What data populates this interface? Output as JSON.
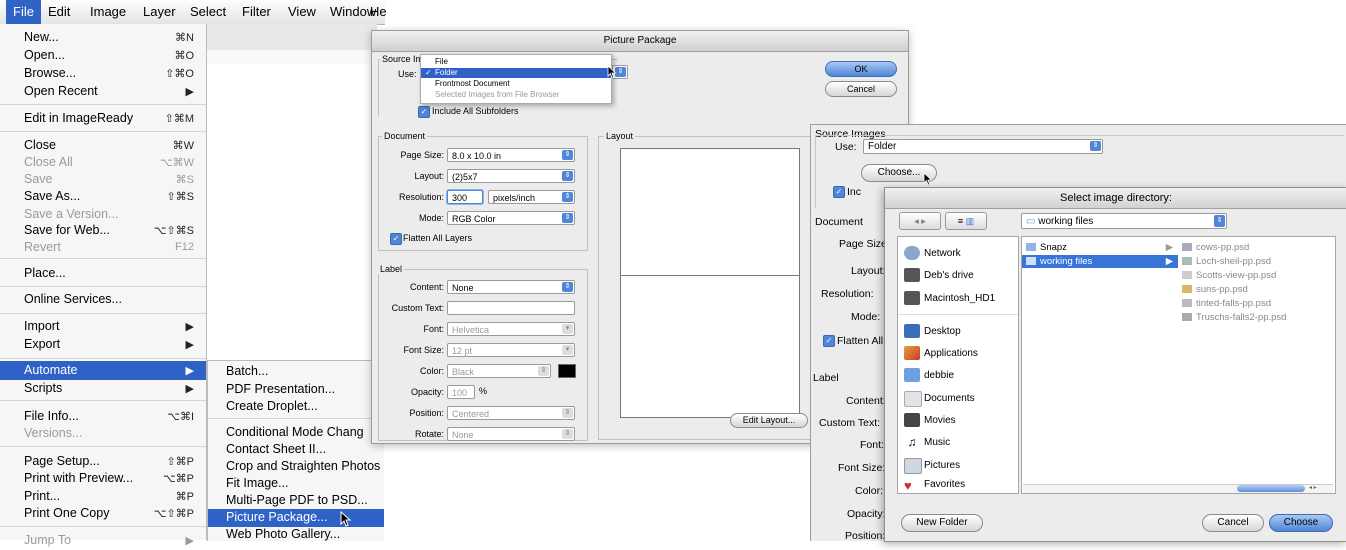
{
  "menubar": [
    "File",
    "Edit",
    "Image",
    "Layer",
    "Select",
    "Filter",
    "View",
    "Window",
    "He"
  ],
  "file_menu": {
    "items": [
      {
        "label": "New...",
        "shortcut": "⌘N",
        "enabled": true
      },
      {
        "label": "Open...",
        "shortcut": "⌘O",
        "enabled": true
      },
      {
        "label": "Browse...",
        "shortcut": "⇧⌘O",
        "enabled": true
      },
      {
        "label": "Open Recent",
        "shortcut": "▶",
        "enabled": true
      },
      {
        "label": "Edit in ImageReady",
        "shortcut": "⇧⌘M",
        "enabled": true
      },
      {
        "label": "Close",
        "shortcut": "⌘W",
        "enabled": true
      },
      {
        "label": "Close All",
        "shortcut": "⌥⌘W",
        "enabled": false
      },
      {
        "label": "Save",
        "shortcut": "⌘S",
        "enabled": false
      },
      {
        "label": "Save As...",
        "shortcut": "⇧⌘S",
        "enabled": true
      },
      {
        "label": "Save a Version...",
        "shortcut": "",
        "enabled": false
      },
      {
        "label": "Save for Web...",
        "shortcut": "⌥⇧⌘S",
        "enabled": true
      },
      {
        "label": "Revert",
        "shortcut": "F12",
        "enabled": false
      },
      {
        "label": "Place...",
        "shortcut": "",
        "enabled": true
      },
      {
        "label": "Online Services...",
        "shortcut": "",
        "enabled": true
      },
      {
        "label": "Import",
        "shortcut": "▶",
        "enabled": true
      },
      {
        "label": "Export",
        "shortcut": "▶",
        "enabled": true
      },
      {
        "label": "Automate",
        "shortcut": "▶",
        "enabled": true,
        "selected": true
      },
      {
        "label": "Scripts",
        "shortcut": "▶",
        "enabled": true
      },
      {
        "label": "File Info...",
        "shortcut": "⌥⌘I",
        "enabled": true
      },
      {
        "label": "Versions...",
        "shortcut": "",
        "enabled": false
      },
      {
        "label": "Page Setup...",
        "shortcut": "⇧⌘P",
        "enabled": true
      },
      {
        "label": "Print with Preview...",
        "shortcut": "⌥⌘P",
        "enabled": true
      },
      {
        "label": "Print...",
        "shortcut": "⌘P",
        "enabled": true
      },
      {
        "label": "Print One Copy",
        "shortcut": "⌥⇧⌘P",
        "enabled": true
      },
      {
        "label": "Jump To",
        "shortcut": "▶",
        "enabled": false
      }
    ]
  },
  "automate_menu": [
    "Batch...",
    "PDF Presentation...",
    "Create Droplet...",
    "Conditional Mode Chang",
    "Contact Sheet II...",
    "Crop and Straighten Photos",
    "Fit Image...",
    "Multi-Page PDF to PSD...",
    "Picture Package...",
    "Web Photo Gallery..."
  ],
  "picture_package": {
    "title": "Picture Package",
    "source_group": "Source Im",
    "use_label": "Use:",
    "use_menu": [
      {
        "label": "File",
        "checked": false
      },
      {
        "label": "Folder",
        "checked": true
      },
      {
        "label": "Frontmost Document",
        "checked": false
      },
      {
        "label": "Selected Images from File Browser",
        "checked": false,
        "disabled": true
      }
    ],
    "include_subfolders": "Include All Subfolders",
    "ok": "OK",
    "cancel": "Cancel",
    "document_group": "Document",
    "page_size_label": "Page Size:",
    "page_size": "8.0 x 10.0 in",
    "layout_label": "Layout:",
    "layout": "(2)5x7",
    "resolution_label": "Resolution:",
    "resolution": "300",
    "resolution_unit": "pixels/inch",
    "mode_label": "Mode:",
    "mode": "RGB Color",
    "flatten": "Flatten All Layers",
    "label_group": "Label",
    "content_label": "Content:",
    "content": "None",
    "custom_text_label": "Custom Text:",
    "custom_text": "",
    "font_label": "Font:",
    "font": "Helvetica",
    "font_size_label": "Font Size:",
    "font_size": "12 pt",
    "color_label": "Color:",
    "color": "Black",
    "opacity_label": "Opacity:",
    "opacity": "100",
    "opacity_unit": "%",
    "position_label": "Position:",
    "position": "Centered",
    "rotate_label": "Rotate:",
    "rotate": "None",
    "layout_group": "Layout",
    "edit_layout": "Edit Layout..."
  },
  "right_dialog": {
    "source_images": "Source Images",
    "use_label": "Use:",
    "use_value": "Folder",
    "choose": "Choose...",
    "include": "Inc",
    "document": "Document",
    "page_size": "Page Size:",
    "layout": "Layout:",
    "resolution": "Resolution:",
    "mode": "Mode:",
    "flatten": "Flatten All",
    "label": "Label",
    "content": "Content:",
    "custom_text": "Custom Text:",
    "font": "Font:",
    "font_size": "Font Size:",
    "color": "Color:",
    "opacity": "Opacity:",
    "position": "Position:"
  },
  "select_dir": {
    "title": "Select image directory:",
    "path": "working files",
    "sidebar": [
      {
        "label": "Network",
        "icon": "network-icon"
      },
      {
        "label": "Deb's drive",
        "icon": "drive-icon"
      },
      {
        "label": "Macintosh_HD1",
        "icon": "drive-icon"
      },
      {
        "label": "Desktop",
        "icon": "desktop-icon"
      },
      {
        "label": "Applications",
        "icon": "applications-icon"
      },
      {
        "label": "debbie",
        "icon": "home-icon"
      },
      {
        "label": "Documents",
        "icon": "documents-icon"
      },
      {
        "label": "Movies",
        "icon": "movies-icon"
      },
      {
        "label": "Music",
        "icon": "music-icon"
      },
      {
        "label": "Pictures",
        "icon": "pictures-icon"
      },
      {
        "label": "Favorites",
        "icon": "favorites-icon"
      }
    ],
    "folders": [
      {
        "label": "Snapz",
        "selected": false
      },
      {
        "label": "working files",
        "selected": true
      }
    ],
    "files": [
      "cows-pp.psd",
      "Loch-sheil-pp.psd",
      "Scotts-view-pp.psd",
      "suns-pp.psd",
      "tinted-falls-pp.psd",
      "Truschs-falls2-pp.psd"
    ],
    "new_folder": "New Folder",
    "cancel": "Cancel",
    "choose": "Choose"
  },
  "colors": {
    "selection": "#2e62c7",
    "aqua": "#4f86d8"
  }
}
